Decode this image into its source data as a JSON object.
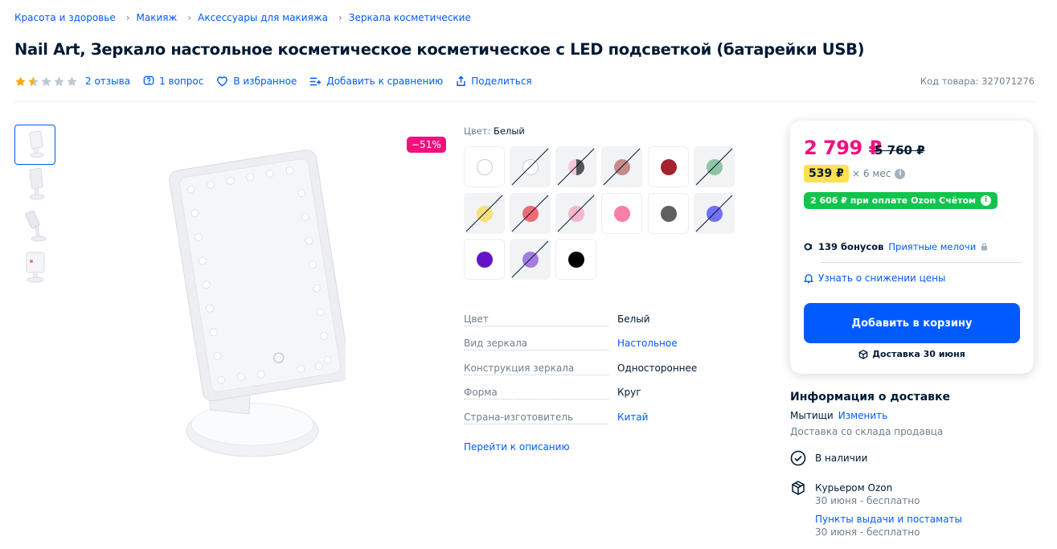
{
  "breadcrumb": [
    "Красота и здоровье",
    "Макияж",
    "Аксессуары для макияжа",
    "Зеркала косметические"
  ],
  "product": {
    "title": "Nail Art, Зеркало настольное косметическое косметическое с LED подсветкой (батарейки USB)",
    "rating": 1.5,
    "reviews": "2 отзыва",
    "questions": "1 вопрос",
    "favorite": "В избранное",
    "compare": "Добавить к сравнению",
    "share": "Поделиться",
    "code": "Код товара: 327071276",
    "discount_badge": "−51%"
  },
  "variants": {
    "label": "Цвет:",
    "selected": "Белый",
    "swatches": [
      {
        "color": "#ffffff",
        "available": true,
        "selected": true
      },
      {
        "color": "#ffffff",
        "available": false
      },
      {
        "color": "#f7c8d8",
        "available": false,
        "half": "#555555"
      },
      {
        "color": "#c98a8a",
        "available": false
      },
      {
        "color": "#a4232f",
        "available": true
      },
      {
        "color": "#8ec4a5",
        "available": false
      },
      {
        "color": "#f7e07a",
        "available": false
      },
      {
        "color": "#f06a74",
        "available": false
      },
      {
        "color": "#f4b6c9",
        "available": false
      },
      {
        "color": "#f77fa8",
        "available": true
      },
      {
        "color": "#606060",
        "available": true
      },
      {
        "color": "#7270f5",
        "available": false
      },
      {
        "color": "#6414c8",
        "available": true
      },
      {
        "color": "#a47ce0",
        "available": false
      },
      {
        "color": "#000000",
        "available": true
      }
    ]
  },
  "specs": [
    {
      "key": "Цвет",
      "value": "Белый",
      "link": false
    },
    {
      "key": "Вид зеркала",
      "value": "Настольное",
      "link": true
    },
    {
      "key": "Конструкция зеркала",
      "value": "Одностороннее",
      "link": false
    },
    {
      "key": "Форма",
      "value": "Круг",
      "link": false
    },
    {
      "key": "Страна-изготовитель",
      "value": "Китай",
      "link": true
    }
  ],
  "go_description": "Перейти к описанию",
  "buy": {
    "price": "2 799 ₽",
    "old_price": "5 760 ₽",
    "installment": "539 ₽",
    "installment_term": "× 6 мес",
    "card_price": "2 606 ₽ при оплате Ozon Счётом",
    "bonus": "139 бонусов",
    "bonus_link": "Приятные мелочи",
    "notify": "Узнать о снижении цены",
    "cart_button": "Добавить в корзину",
    "delivery": "Доставка 30 июня"
  },
  "delivery_info": {
    "title": "Информация о доставке",
    "city": "Мытищи",
    "change": "Изменить",
    "warehouse": "Доставка со склада продавца",
    "in_stock": "В наличии",
    "courier": "Курьером Ozon",
    "courier_date": "30 июня - бесплатно",
    "pickup": "Пункты выдачи и постаматы",
    "pickup_date": "30 июня - бесплатно"
  },
  "colors": {
    "accent": "#005bff",
    "price": "#f1117e",
    "green": "#10c44c",
    "yellow": "#ffe14d",
    "star": "#ffa800"
  }
}
